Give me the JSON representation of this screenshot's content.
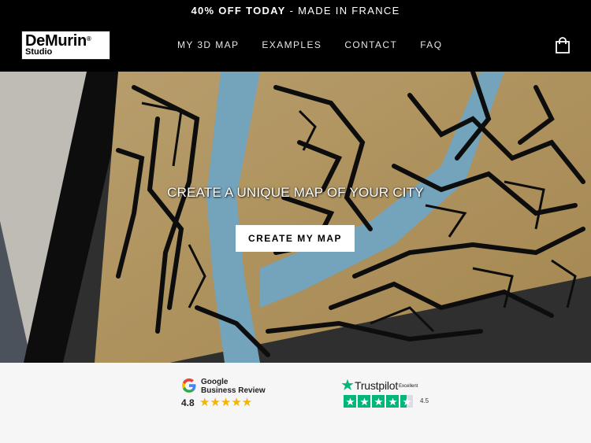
{
  "announcement": {
    "bold": "40% OFF TODAY",
    "rest": " - MADE IN FRANCE"
  },
  "logo": {
    "main": "DeMurin",
    "reg": "®",
    "sub": "Studio"
  },
  "nav": {
    "items": [
      "MY 3D MAP",
      "EXAMPLES",
      "CONTACT",
      "FAQ"
    ]
  },
  "cart": {
    "icon": "shopping-bag-icon"
  },
  "hero": {
    "title": "CREATE A UNIQUE MAP OF YOUR CITY",
    "cta_label": "CREATE MY MAP"
  },
  "reviews": {
    "google": {
      "line1": "Google",
      "line2": "Business Review",
      "rating": "4.8",
      "stars": "★★★★★"
    },
    "trustpilot": {
      "brand": "Trustpilot",
      "word": "Excellent",
      "score": "4.5"
    }
  },
  "colors": {
    "header_bg": "#000000",
    "footer_bg": "#f6f6f6",
    "star_gold": "#f5b400",
    "trustpilot_green": "#00b67a",
    "wood": "#d9b877",
    "river": "#8ec7e6"
  }
}
